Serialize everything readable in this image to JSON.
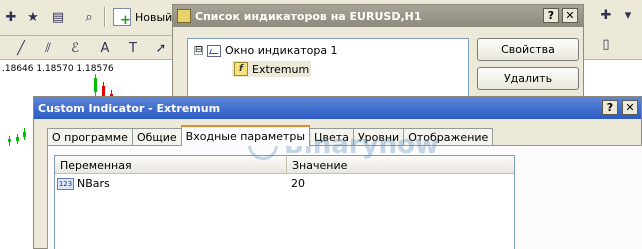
{
  "toolbar": {
    "new_order_label": "Новый"
  },
  "chart": {
    "quote_line": ".18646 1.18570 1.18576"
  },
  "indicators_window": {
    "title": "Список индикаторов на EURUSD,H1",
    "help_label": "?",
    "close_label": "✕",
    "tree": {
      "root_expander": "⊟",
      "root_label": "Окно индикатора 1",
      "child_label": "Extremum",
      "child_icon": "f"
    },
    "buttons": {
      "properties_label": "Свойства",
      "delete_label": "Удалить"
    }
  },
  "custom_indicator_dialog": {
    "title": "Custom Indicator - Extremum",
    "help_label": "?",
    "close_label": "✕",
    "tabs": [
      {
        "label": "О программе"
      },
      {
        "label": "Общие"
      },
      {
        "label": "Входные параметры",
        "active": true
      },
      {
        "label": "Цвета"
      },
      {
        "label": "Уровни"
      },
      {
        "label": "Отображение"
      }
    ],
    "params_table": {
      "columns": [
        "Переменная",
        "Значение"
      ],
      "rows": [
        {
          "icon": "123",
          "variable": "NBars",
          "value": "20"
        }
      ]
    }
  },
  "watermark": {
    "text": "Binarynow"
  },
  "colors": {
    "accent": "#2a5ac4",
    "tab_highlight": "#e68b2c",
    "candle_up": "#00c000",
    "candle_down": "#e00000"
  }
}
